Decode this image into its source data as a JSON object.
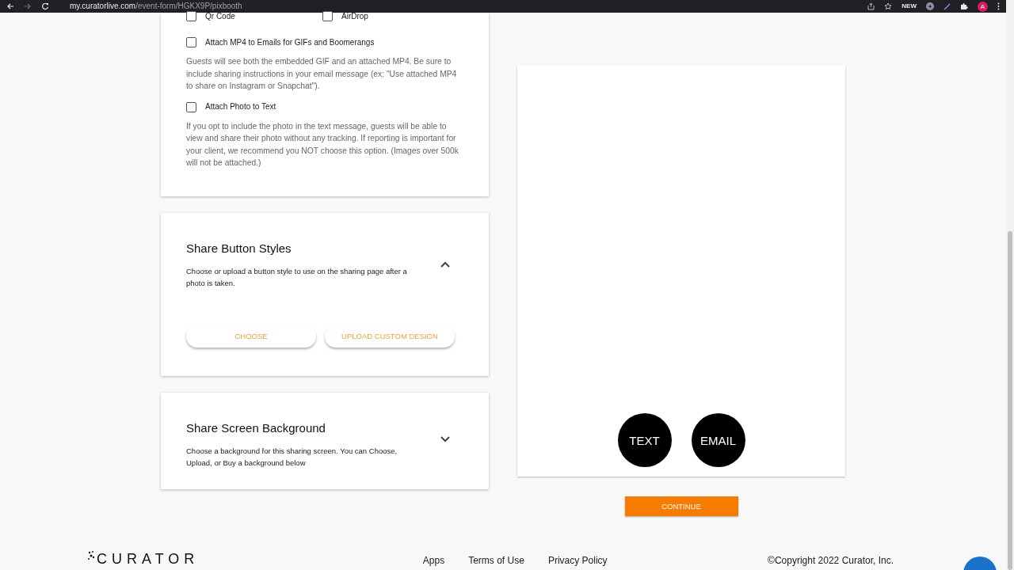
{
  "browser": {
    "url_host": "my.curatorlive.com",
    "url_path": "/event-form/HGKX9P/pixbooth",
    "extension_badge": "NEW",
    "profile_initial": "A"
  },
  "share_options": [
    {
      "label": "Qr Code",
      "checked": false
    },
    {
      "label": "AirDrop",
      "checked": false
    }
  ],
  "attachments": [
    {
      "label": "Attach MP4 to Emails for GIFs and Boomerangs",
      "checked": false,
      "description": "Guests will see both the embedded GIF and an attached MP4. Be sure to include sharing instructions in your email message (ex: \"Use attached MP4 to share on Instagram or Snapchat\")."
    },
    {
      "label": "Attach Photo to Text",
      "checked": false,
      "description": "If you opt to include the photo in the text message, guests will be able to view and share their photo without any tracking. If reporting is important for your client, we recommend you NOT choose this option. (Images over 500k will not be attached.)"
    }
  ],
  "sections": [
    {
      "title": "Share Button Styles",
      "description": "Choose or upload a button style to use on the sharing page after a photo is taken.",
      "expanded": true,
      "buttons": [
        "CHOOSE",
        "UPLOAD CUSTOM DESIGN"
      ]
    },
    {
      "title": "Share Screen Background",
      "description": "Choose a background for this sharing screen. You can Choose, Upload, or Buy a background below",
      "expanded": false
    }
  ],
  "preview": {
    "share_buttons": [
      "TEXT",
      "EMAIL"
    ]
  },
  "continue_button": "CONTINUE",
  "footer": {
    "logo": "CURATOR",
    "links": [
      "Apps",
      "Terms of Use",
      "Privacy Policy"
    ],
    "copyright": "©Copyright 2022 Curator, Inc."
  }
}
